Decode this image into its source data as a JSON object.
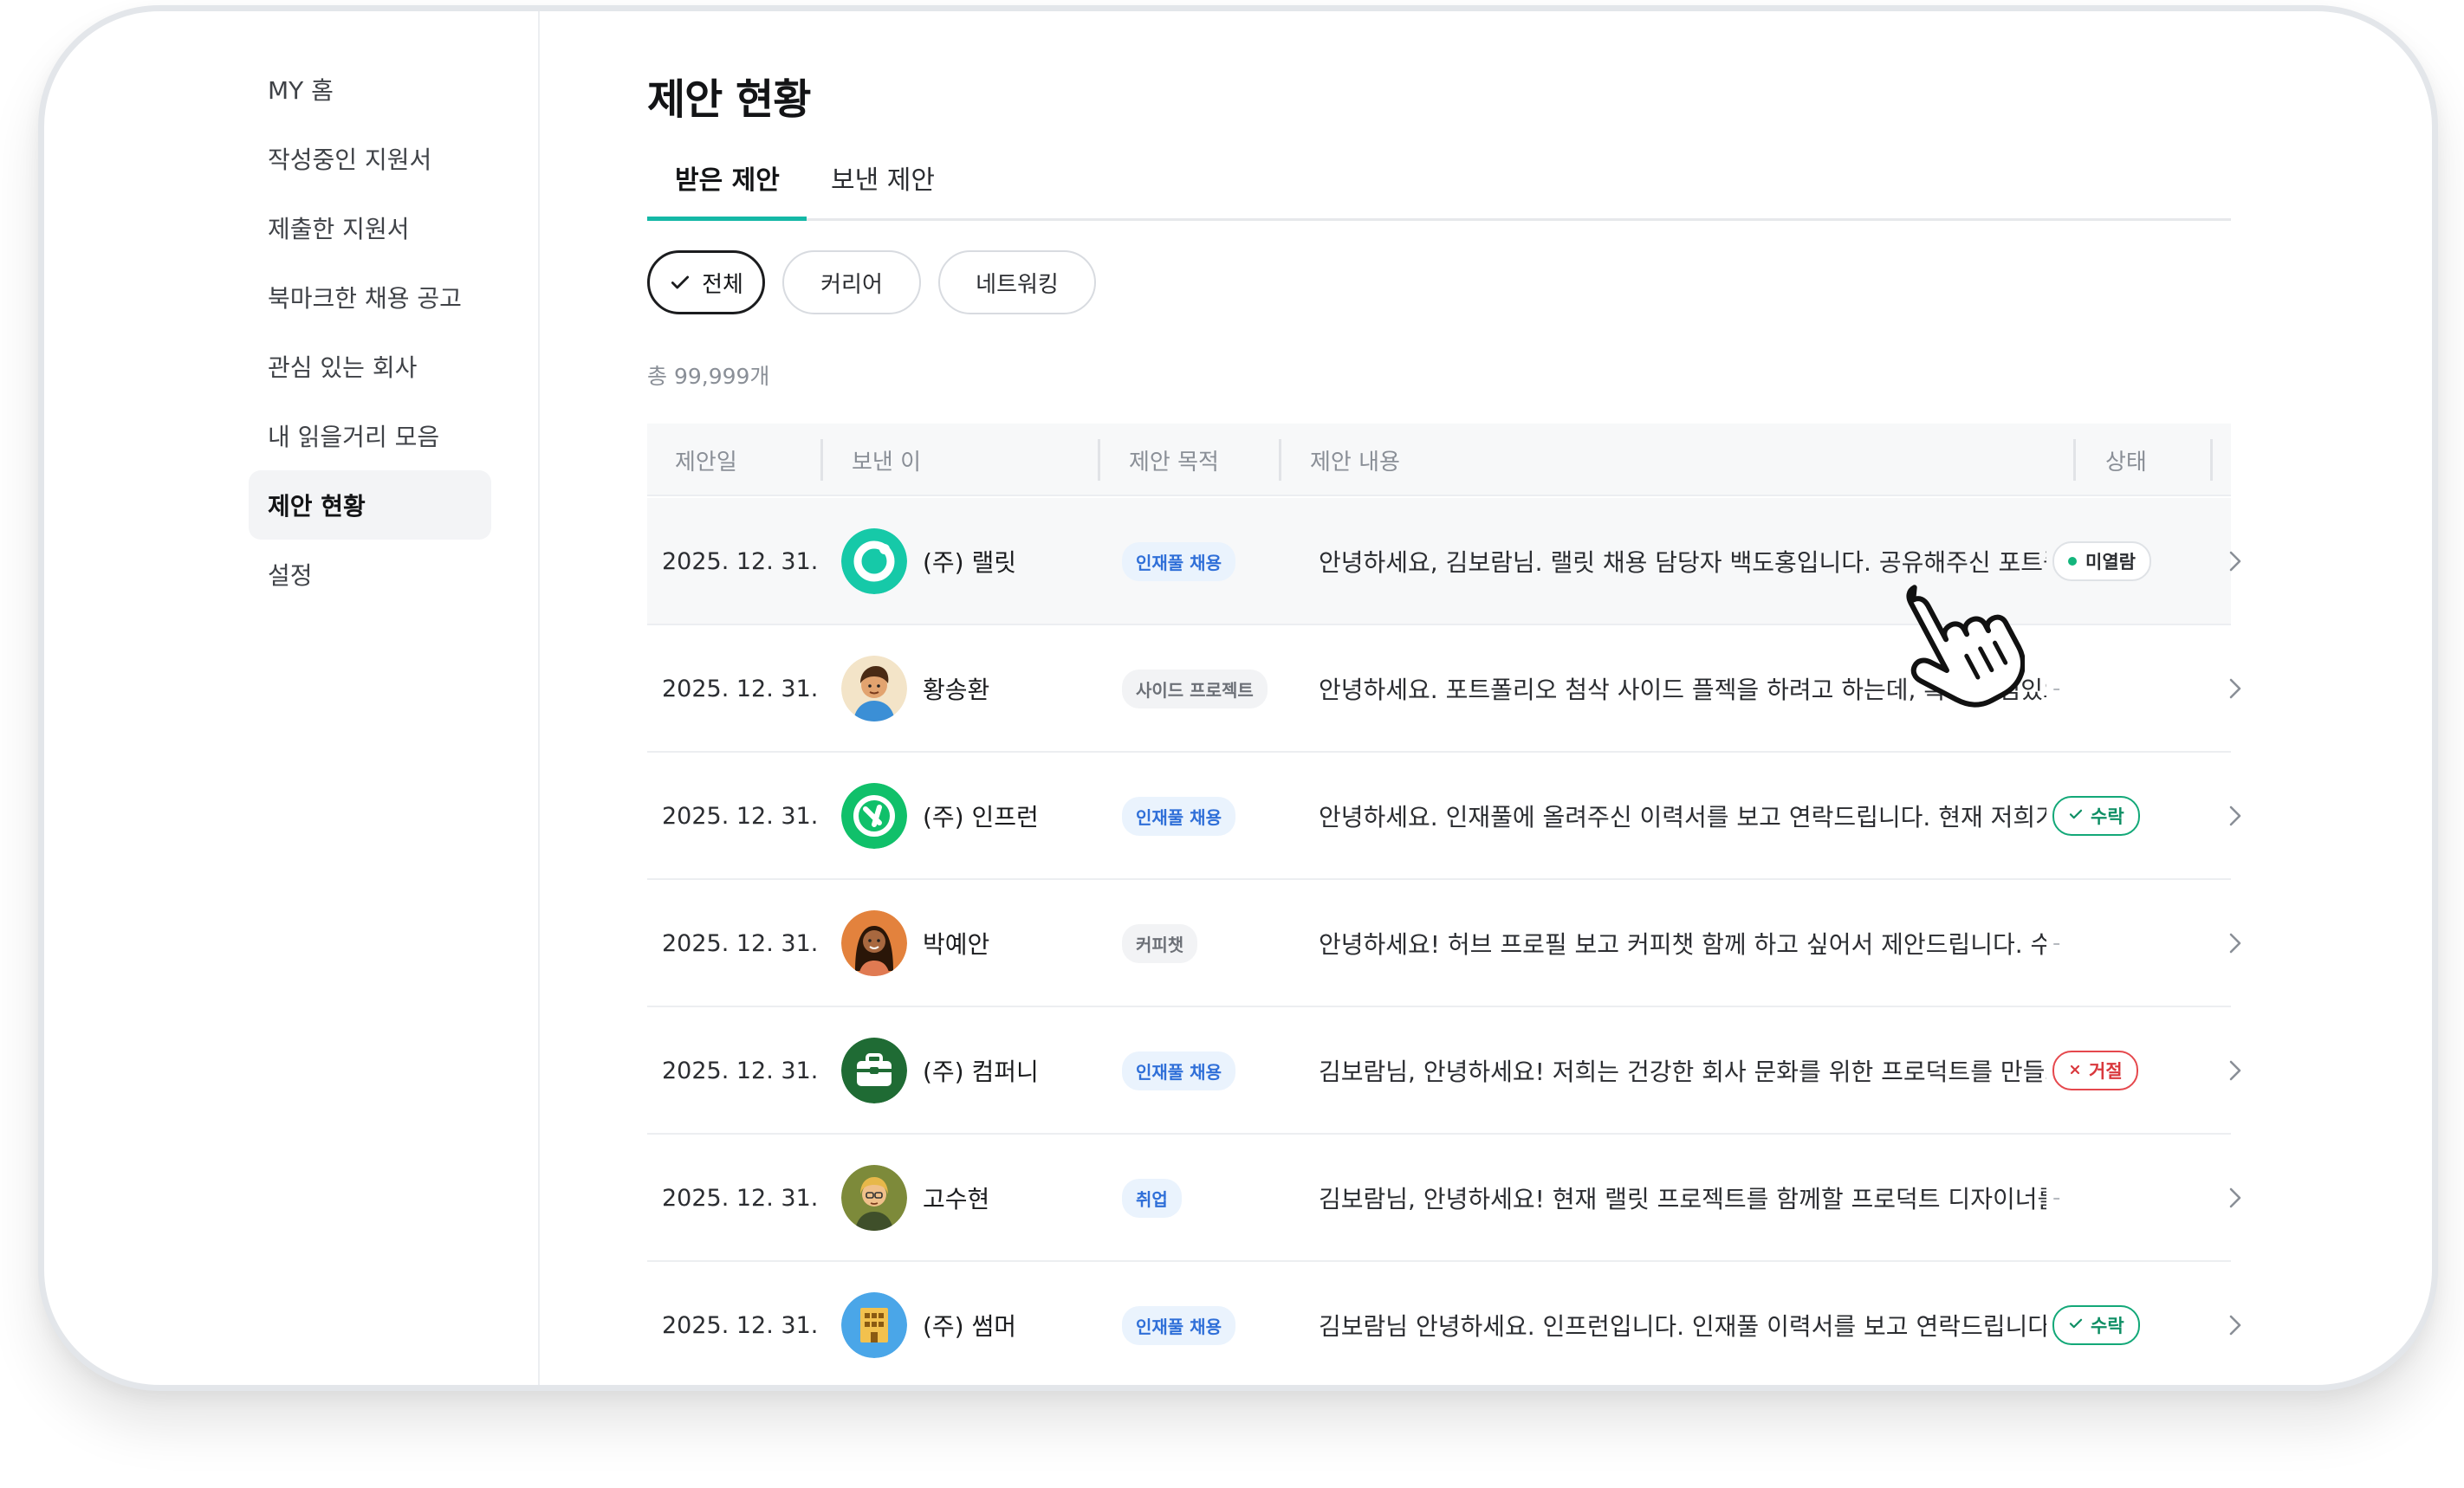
{
  "sidebar": {
    "items": [
      {
        "label": "MY 홈",
        "active": false
      },
      {
        "label": "작성중인 지원서",
        "active": false
      },
      {
        "label": "제출한 지원서",
        "active": false
      },
      {
        "label": "북마크한 채용 공고",
        "active": false
      },
      {
        "label": "관심 있는 회사",
        "active": false
      },
      {
        "label": "내 읽을거리 모음",
        "active": false
      },
      {
        "label": "제안 현황",
        "active": true
      },
      {
        "label": "설정",
        "active": false
      }
    ]
  },
  "main": {
    "title": "제안 현황",
    "tabs": [
      {
        "label": "받은 제안",
        "active": true
      },
      {
        "label": "보낸 제안",
        "active": false
      }
    ],
    "filters": [
      {
        "label": "전체",
        "selected": true
      },
      {
        "label": "커리어",
        "selected": false
      },
      {
        "label": "네트워킹",
        "selected": false
      }
    ],
    "total_count": "총 99,999개",
    "table": {
      "headers": [
        "제안일",
        "보낸 이",
        "제안 목적",
        "제안 내용",
        "상태"
      ],
      "rows": [
        {
          "date": "2025. 12. 31.",
          "sender": "(주) 랠릿",
          "purpose": "인재풀 채용",
          "purpose_style": "blue",
          "content": "안녕하세요, 김보람님. 랠릿 채용 담당자 백도홍입니다. 공유해주신 포트폴...",
          "status": "미열람",
          "status_type": "unread",
          "avatar": "rallit-logo"
        },
        {
          "date": "2025. 12. 31.",
          "sender": "황송환",
          "purpose": "사이드 프로젝트",
          "purpose_style": "gray",
          "content": "안녕하세요. 포트폴리오 첨삭 사이드 플젝을 하려고 하는데, 혹시 관심있으...",
          "status": "-",
          "status_type": "none",
          "avatar": "person-avatar-1"
        },
        {
          "date": "2025. 12. 31.",
          "sender": "(주) 인프런",
          "purpose": "인재풀 채용",
          "purpose_style": "blue",
          "content": "안녕하세요. 인재풀에 올려주신 이력서를 보고 연락드립니다. 현재 저희가...",
          "status": "수락",
          "status_type": "accept",
          "avatar": "inflearn-logo"
        },
        {
          "date": "2025. 12. 31.",
          "sender": "박예안",
          "purpose": "커피챗",
          "purpose_style": "gray",
          "content": "안녕하세요! 허브 프로필 보고 커피챗 함께 하고 싶어서 제안드립니다. 수락...",
          "status": "-",
          "status_type": "none",
          "avatar": "person-avatar-2"
        },
        {
          "date": "2025. 12. 31.",
          "sender": "(주) 컴퍼니",
          "purpose": "인재풀 채용",
          "purpose_style": "blue",
          "content": "김보람님, 안녕하세요! 저희는 건강한 회사 문화를 위한 프로덕트를 만들고...",
          "status": "거절",
          "status_type": "reject",
          "avatar": "briefcase-logo"
        },
        {
          "date": "2025. 12. 31.",
          "sender": "고수현",
          "purpose": "취업",
          "purpose_style": "blue",
          "content": "김보람님, 안녕하세요! 현재 랠릿 프로젝트를 함께할 프로덕트 디자이너를...",
          "status": "-",
          "status_type": "none",
          "avatar": "person-avatar-3"
        },
        {
          "date": "2025. 12. 31.",
          "sender": "(주) 썸머",
          "purpose": "인재풀 채용",
          "purpose_style": "blue",
          "content": "김보람님 안녕하세요. 인프런입니다. 인재풀 이력서를 보고 연락드립니다....",
          "status": "수락",
          "status_type": "accept",
          "avatar": "building-logo"
        }
      ]
    }
  },
  "colors": {
    "accent": "#14b8a6",
    "accept": "#13a878",
    "reject": "#e5484d",
    "badge_blue": "#2f6fd8"
  }
}
